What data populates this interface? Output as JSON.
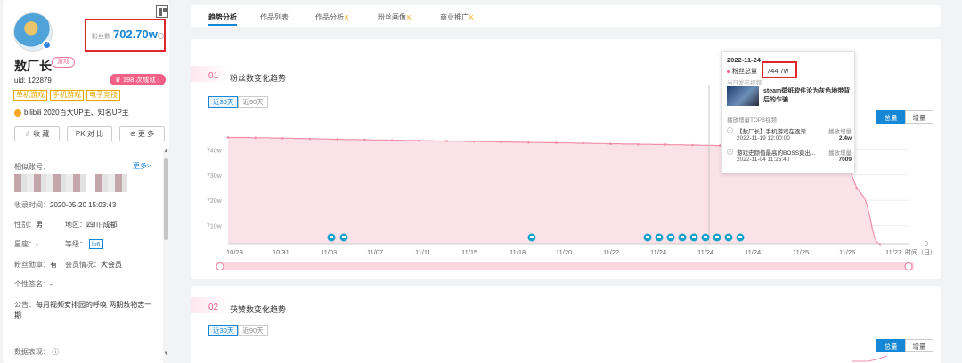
{
  "profile": {
    "fans_label": "粉丝数",
    "fans_value": "702.70w",
    "name": "敖厂长",
    "category_tag": "游戏",
    "uid": "uid: 122879",
    "achievement": "198 次成就",
    "tags": [
      "单机游戏",
      "手机游戏",
      "电子竞技"
    ],
    "up_desc": "bilibili 2020百大UP主、知名UP主",
    "buttons": {
      "favorite": "收 藏",
      "compare": "对 比",
      "more": "更 多"
    }
  },
  "similar": {
    "label": "相似账号：",
    "more": "更多>"
  },
  "info": {
    "record_time_label": "收录时间：",
    "record_time": "2020-05-20 15:03:43",
    "gender_label": "性别：",
    "gender": "男",
    "region_label": "地区：",
    "region": "四川-成都",
    "zodiac_label": "星座：",
    "zodiac": "-",
    "level_label": "等级：",
    "level": "lv6",
    "medal_label": "粉丝勋章：",
    "medal": "有",
    "member_label": "会员情况：",
    "member": "大会员",
    "sign_label": "个性签名：",
    "sign": "-",
    "notice_label": "公告：",
    "notice": "每月视频安排园的呼唤 两期敖物志一期",
    "data_label": "数据表现："
  },
  "tabs": [
    {
      "label": "趋势分析",
      "vip": ""
    },
    {
      "label": "作品列表",
      "vip": ""
    },
    {
      "label": "作品分析",
      "vip": "K"
    },
    {
      "label": "粉丝画像",
      "vip": "K"
    },
    {
      "label": "商业推广",
      "vip": "K"
    }
  ],
  "card1": {
    "num": "01",
    "title": "粉丝数变化趋势",
    "range_30": "近30天",
    "range_90": "近90天",
    "total": "总量",
    "incr": "增量",
    "x_unit": "时间（日）"
  },
  "card2": {
    "num": "02",
    "title": "获赞数变化趋势",
    "range_30": "近30天",
    "range_90": "近90天",
    "total": "总量",
    "incr": "增量"
  },
  "chart_data": {
    "type": "area",
    "x_tick_labels": [
      "10/29",
      "10/31",
      "11/03",
      "11/07",
      "11/11",
      "11/15",
      "11/18",
      "11/20",
      "11/22",
      "11/24",
      "11/24",
      "11/24",
      "11/25",
      "11/26",
      "11/27"
    ],
    "y_tick_labels": [
      "740w",
      "730w",
      "720w",
      "710w",
      "0"
    ],
    "series": [
      {
        "values": [
          744.9,
          744.9,
          744.9,
          744.9,
          744.9,
          744.9,
          744.9,
          744.9,
          744.9,
          744.9,
          744.9,
          744.9,
          744.8,
          744.8,
          744.8,
          744.8,
          744.8,
          744.8,
          744.8,
          744.8,
          744.8,
          744.8,
          744.7,
          744.7,
          744.7,
          744.7,
          744.7,
          744.6,
          744.6,
          744.6,
          744.6,
          744.6,
          744.6,
          744.6,
          744.5,
          744.5,
          744.5,
          744.5,
          744.5,
          744.5,
          744.4,
          744.4,
          744.4,
          744.4,
          744.4,
          744.4,
          744.4,
          744.3,
          744.3,
          744.3,
          744.3,
          744.3,
          744.3,
          744.2,
          744.2,
          744.2,
          744.2,
          744.2,
          744.2,
          744.2,
          744.1,
          744.1,
          744.1,
          744.1,
          744.1,
          744.1,
          744.0,
          744.0,
          744.0,
          744.0,
          744.0,
          744.0,
          744.0,
          743.9,
          743.9,
          743.9,
          743.9,
          743.9,
          743.9,
          743.9,
          743.9,
          743.9,
          743.8,
          743.8,
          743.8,
          743.8,
          743.8,
          743.8,
          743.8,
          743.8,
          743.7,
          743.7,
          743.7,
          743.7,
          743.7,
          743.7,
          743.7,
          743.7,
          743.6,
          743.6,
          743.6,
          743.6,
          743.6,
          743.6,
          743.6,
          743.6,
          743.5,
          743.5,
          743.5,
          743.5,
          743.5,
          743.5,
          743.5,
          743.5,
          743.4,
          743.4,
          743.4,
          743.4,
          743.4,
          743.4,
          743.4,
          743.4,
          743.3,
          743.3,
          743.3,
          743.3,
          743.3,
          743.3,
          743.3,
          743.3,
          743.2,
          743.2,
          743.2,
          743.2,
          743.2,
          743.2,
          743.2,
          743.2,
          743.1,
          743.1,
          743.1,
          743.1,
          743.1,
          743.1,
          743.1,
          743.1,
          743.0,
          743.0,
          743.0,
          743.0,
          743.0,
          743.0,
          743.0,
          743.0,
          742.9,
          742.9,
          742.9,
          742.9,
          742.9,
          742.9,
          742.9,
          742.9,
          742.8,
          742.8,
          742.8,
          742.8,
          742.8,
          742.8,
          742.8,
          742.8,
          742.7,
          742.7,
          742.7,
          742.7,
          742.7,
          742.7,
          742.7,
          742.7,
          742.6,
          742.6,
          742.6,
          742.6,
          742.6,
          742.6,
          742.6,
          742.6,
          742.5,
          742.5,
          742.5,
          742.5,
          742.5,
          742.5,
          742.5,
          742.5,
          742.4,
          742.4,
          742.4,
          742.4,
          742.4,
          742.4,
          742.4,
          742.4,
          742.3,
          742.3,
          742.3,
          742.3,
          742.3,
          742.3,
          742.3,
          742.3,
          742.2,
          742.2,
          742.2,
          742.2,
          742.2,
          742.2,
          742.2,
          742.2,
          742.1,
          742.1,
          742.1,
          742.1,
          742.1,
          742.1,
          742.1,
          742.1,
          742.0,
          742.0,
          742.0,
          742.0,
          742.0,
          742.0,
          742.0,
          742.0,
          741.9,
          741.9,
          741.9,
          741.9,
          741.9,
          741.9,
          741.9,
          741.9,
          741.8,
          741.8,
          741.8,
          741.8,
          741.8,
          741.8,
          741.8,
          741.8,
          741.7,
          741.7,
          741.7,
          741.7,
          741.7,
          741.7,
          741.7,
          741.7,
          741.6,
          741.6,
          741.6,
          741.6,
          741.6,
          741.6,
          741.6,
          741.6,
          741.5,
          741.5,
          741.5,
          741.5,
          741.5,
          741.5,
          741.5,
          741.5,
          741.4,
          741.4,
          741.4,
          741.4,
          741.4,
          741.4,
          741.4,
          741.4,
          741.3,
          741.3,
          741.3,
          741.3,
          741.3,
          741.3,
          741.3,
          741.3,
          741.2,
          741.2,
          741.2,
          741.2,
          741.2,
          741.2,
          741.2,
          741.2,
          741.1,
          741.1,
          741.1,
          741.1,
          741.1,
          741.1,
          741.1,
          741.1,
          741.0,
          741.0,
          741.0,
          741.0,
          741.0,
          741.0,
          741.0,
          741.0,
          740.5,
          739.5,
          738.0,
          736.0,
          734.0,
          731.5,
          729.0,
          727.0,
          725.0,
          724.0,
          723.0,
          722.0,
          721.0,
          719.0,
          716.0,
          713.0,
          709.0,
          706.0,
          704.0,
          703.0,
          702.7
        ],
        "sample_count_note": ""
      }
    ],
    "ylim": [
      700,
      750
    ],
    "grid": true,
    "video_markers": 11
  },
  "tooltip": {
    "date": "2022-11-24",
    "series_label": "粉丝总量",
    "value": "744.7w",
    "sub": "当日发布视频",
    "video_title": "steam壁纸软件沦为灰色地带背后的乍骗",
    "top3_label": "播放增量TOP3视频",
    "rows": [
      {
        "n": "1",
        "title": "【敖厂长】手机游戏在逐渐...",
        "time": "2022-11-19 12:00:00",
        "head": "播放增量",
        "value": "2.4w"
      },
      {
        "n": "2",
        "title": "游戏史颜值最高的BOSS竟出...",
        "time": "2022-11-04 11:25:40",
        "head": "播放增量",
        "value": "7009"
      }
    ]
  }
}
